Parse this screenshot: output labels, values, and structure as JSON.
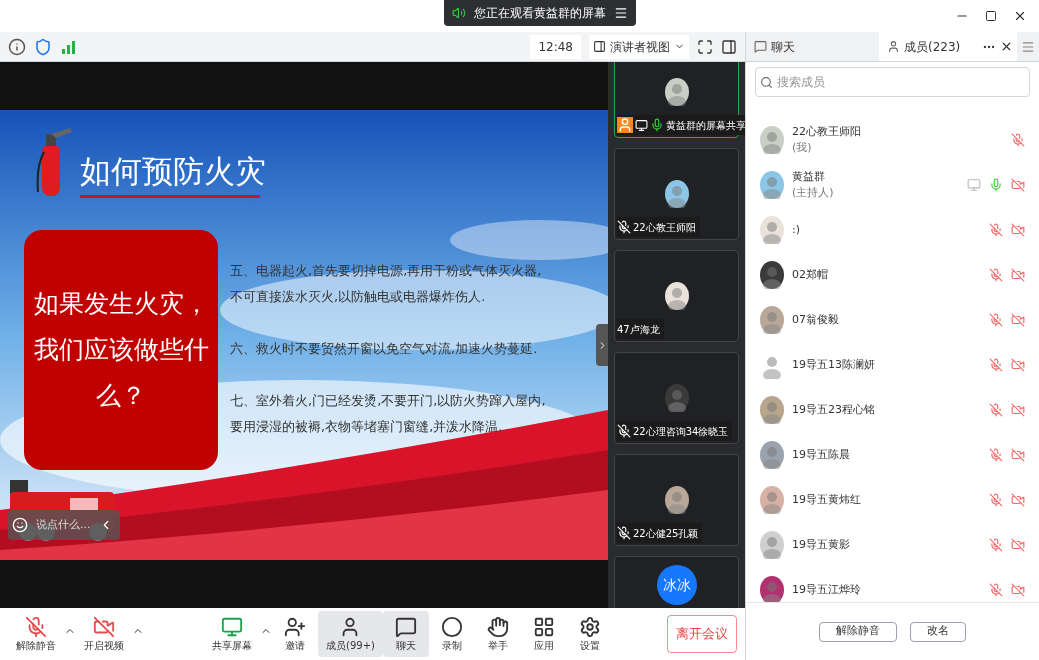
{
  "banner": {
    "text": "您正在观看黄益群的屏幕"
  },
  "info_bar": {
    "time": "12:48",
    "view_button": "演讲者视图"
  },
  "slide": {
    "title": "如何预防火灾",
    "callout": "如果发生火灾，我们应该做些什么？",
    "paragraphs": [
      "五、电器起火,首先要切掉电源,再用干粉或气体灭火器, 不可直接泼水灭火,以防触电或电器爆炸伤人.",
      "六、救火时不要贸然开窗以免空气对流,加速火势蔓延.",
      "七、室外着火,门已经发烫,不要开门,以防火势蹿入屋内,要用浸湿的被褥,衣物等堵塞门窗缝,并泼水降温."
    ],
    "chat_placeholder": "说点什么..."
  },
  "videos": [
    {
      "name": "黄益群的屏幕共享",
      "mic": {
        "muted": false
      },
      "host": true,
      "sharing": true,
      "active": true
    },
    {
      "name": "22心教王师阳",
      "mic": {
        "muted": true
      },
      "host": false,
      "sharing": false,
      "active": false
    },
    {
      "name": "47卢海龙",
      "host": false,
      "sharing": false,
      "active": false
    },
    {
      "name": "22心理咨询34徐晓玉",
      "mic": {
        "muted": true
      },
      "host": false,
      "sharing": false,
      "active": false
    },
    {
      "name": "22心健25孔颖",
      "mic": {
        "muted": true
      },
      "host": false,
      "sharing": false,
      "active": false
    },
    {
      "avatar_text": "冰冰",
      "active": false
    }
  ],
  "toolbar": [
    {
      "label": "解除静音",
      "kind": "mic",
      "menu": true,
      "selected": false
    },
    {
      "label": "开启视频",
      "kind": "video",
      "menu": true,
      "selected": false
    },
    {
      "label": "共享屏幕",
      "kind": "share",
      "menu": true,
      "selected": false
    },
    {
      "label": "邀请",
      "kind": "invite",
      "menu": false,
      "selected": false
    },
    {
      "label": "成员(99+)",
      "kind": "members",
      "menu": false,
      "selected": true
    },
    {
      "label": "聊天",
      "kind": "chat",
      "menu": false,
      "selected": true
    },
    {
      "label": "录制",
      "kind": "record",
      "menu": false,
      "selected": false
    },
    {
      "label": "举手",
      "kind": "hand",
      "menu": false,
      "selected": false
    },
    {
      "label": "应用",
      "kind": "apps",
      "menu": false,
      "selected": false
    },
    {
      "label": "设置",
      "kind": "settings",
      "menu": false,
      "selected": false
    }
  ],
  "leave_button": "离开会议",
  "panel": {
    "tabs": [
      {
        "label": "聊天",
        "selected": false
      },
      {
        "label": "成员(223)",
        "selected": true
      }
    ],
    "search": {
      "placeholder": "搜索成员"
    },
    "members": [
      {
        "name": "22心教王师阳",
        "role": "(我)",
        "sharing": false,
        "mic": {
          "muted": true
        },
        "camera_off": false
      },
      {
        "name": "黄益群",
        "role": "(主持人)",
        "sharing": true,
        "mic": {
          "muted": false
        },
        "camera_off": true
      },
      {
        "name": ":)",
        "sharing": false,
        "mic": {
          "muted": true
        },
        "camera_off": true
      },
      {
        "name": "02郑帽",
        "sharing": false,
        "mic": {
          "muted": true
        },
        "camera_off": true
      },
      {
        "name": "07翁俊毅",
        "sharing": false,
        "mic": {
          "muted": true
        },
        "camera_off": true
      },
      {
        "name": "19导五13陈澜妍",
        "sharing": false,
        "mic": {
          "muted": true
        },
        "camera_off": true
      },
      {
        "name": "19导五23程心铭",
        "sharing": false,
        "mic": {
          "muted": true
        },
        "camera_off": true
      },
      {
        "name": "19导五陈晨",
        "sharing": false,
        "mic": {
          "muted": true
        },
        "camera_off": true
      },
      {
        "name": "19导五黄炜红",
        "sharing": false,
        "mic": {
          "muted": true
        },
        "camera_off": true
      },
      {
        "name": "19导五黄影",
        "sharing": false,
        "mic": {
          "muted": true
        },
        "camera_off": true
      },
      {
        "name": "19导五江烨玲",
        "sharing": false,
        "mic": {
          "muted": true
        },
        "camera_off": true
      }
    ],
    "buttons": [
      "解除静音",
      "改名"
    ]
  }
}
